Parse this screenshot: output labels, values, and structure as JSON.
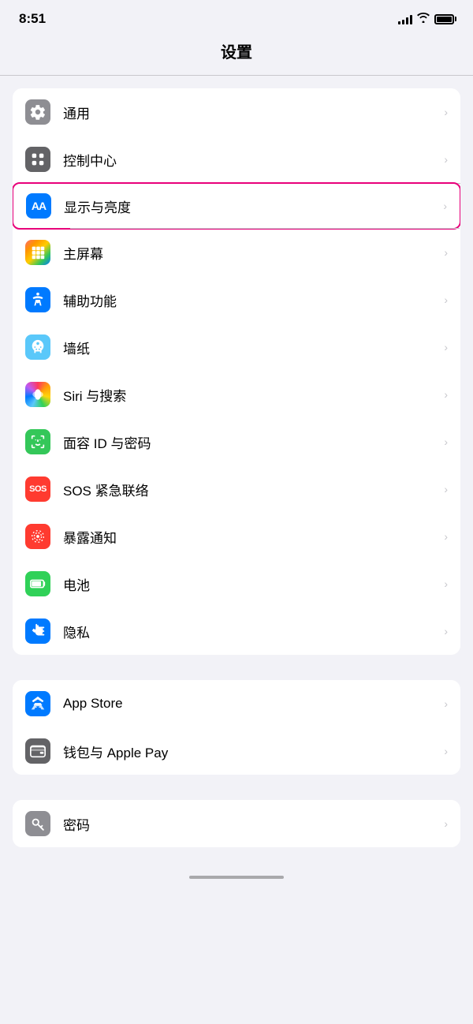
{
  "statusBar": {
    "time": "8:51",
    "battery": 100
  },
  "pageTitle": "设置",
  "groups": [
    {
      "id": "group1",
      "items": [
        {
          "id": "general",
          "label": "通用",
          "icon": "gear",
          "iconBg": "gray",
          "highlighted": false
        },
        {
          "id": "control-center",
          "label": "控制中心",
          "icon": "toggles",
          "iconBg": "gray2",
          "highlighted": false
        },
        {
          "id": "display",
          "label": "显示与亮度",
          "icon": "AA",
          "iconBg": "blue",
          "highlighted": true
        },
        {
          "id": "home-screen",
          "label": "主屏幕",
          "icon": "grid",
          "iconBg": "colorful",
          "highlighted": false
        },
        {
          "id": "accessibility",
          "label": "辅助功能",
          "icon": "person-circle",
          "iconBg": "blue2",
          "highlighted": false
        },
        {
          "id": "wallpaper",
          "label": "墙纸",
          "icon": "flower",
          "iconBg": "blue3",
          "highlighted": false
        },
        {
          "id": "siri",
          "label": "Siri 与搜索",
          "icon": "siri",
          "iconBg": "siri",
          "highlighted": false
        },
        {
          "id": "face-id",
          "label": "面容 ID 与密码",
          "icon": "faceid",
          "iconBg": "green",
          "highlighted": false
        },
        {
          "id": "sos",
          "label": "SOS 紧急联络",
          "icon": "SOS",
          "iconBg": "red",
          "highlighted": false
        },
        {
          "id": "exposure",
          "label": "暴露通知",
          "icon": "exposure",
          "iconBg": "exposure",
          "highlighted": false
        },
        {
          "id": "battery",
          "label": "电池",
          "icon": "battery",
          "iconBg": "green2",
          "highlighted": false
        },
        {
          "id": "privacy",
          "label": "隐私",
          "icon": "hand",
          "iconBg": "blue2",
          "highlighted": false
        }
      ]
    },
    {
      "id": "group2",
      "items": [
        {
          "id": "app-store",
          "label": "App Store",
          "icon": "appstore",
          "iconBg": "blue2",
          "highlighted": false
        },
        {
          "id": "wallet",
          "label": "钱包与 Apple Pay",
          "icon": "wallet",
          "iconBg": "gray2",
          "highlighted": false
        }
      ]
    },
    {
      "id": "group3",
      "items": [
        {
          "id": "passwords",
          "label": "密码",
          "icon": "key",
          "iconBg": "gray",
          "highlighted": false
        }
      ]
    }
  ]
}
